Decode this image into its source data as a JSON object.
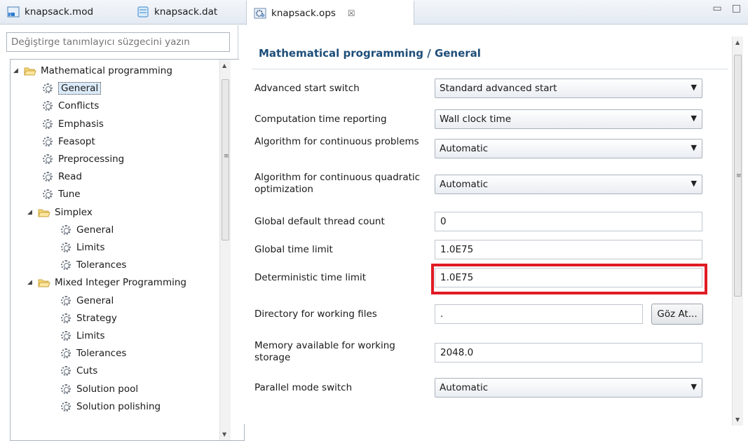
{
  "tabs": [
    {
      "label": "knapsack.mod",
      "icon": "mod-file-icon"
    },
    {
      "label": "knapsack.dat",
      "icon": "data-file-icon"
    },
    {
      "label": "knapsack.ops",
      "icon": "settings-file-icon",
      "active": true,
      "close": "☒"
    }
  ],
  "window_controls": {
    "minimize": "▭",
    "maximize": "□"
  },
  "filter": {
    "placeholder": "Değiştirge tanımlayıcı süzgecini yazın"
  },
  "tree": [
    {
      "label": "Mathematical programming",
      "type": "folder"
    },
    {
      "label": "General",
      "type": "leaf",
      "selected": true
    },
    {
      "label": "Conflicts",
      "type": "leaf"
    },
    {
      "label": "Emphasis",
      "type": "leaf"
    },
    {
      "label": "Feasopt",
      "type": "leaf"
    },
    {
      "label": "Preprocessing",
      "type": "leaf"
    },
    {
      "label": "Read",
      "type": "leaf"
    },
    {
      "label": "Tune",
      "type": "leaf"
    },
    {
      "label": "Simplex",
      "type": "folder"
    },
    {
      "label": "General",
      "type": "leaf"
    },
    {
      "label": "Limits",
      "type": "leaf"
    },
    {
      "label": "Tolerances",
      "type": "leaf"
    },
    {
      "label": "Mixed Integer Programming",
      "type": "folder"
    },
    {
      "label": "General",
      "type": "leaf"
    },
    {
      "label": "Strategy",
      "type": "leaf"
    },
    {
      "label": "Limits",
      "type": "leaf"
    },
    {
      "label": "Tolerances",
      "type": "leaf"
    },
    {
      "label": "Cuts",
      "type": "leaf"
    },
    {
      "label": "Solution pool",
      "type": "leaf"
    },
    {
      "label": "Solution polishing",
      "type": "leaf"
    }
  ],
  "panel": {
    "title": "Mathematical programming / General",
    "fields": [
      {
        "label": "Advanced start switch",
        "kind": "select",
        "value": "Standard advanced start"
      },
      {
        "label": "Computation time reporting",
        "kind": "select",
        "value": "Wall clock time"
      },
      {
        "label": "Algorithm for continuous problems",
        "kind": "select",
        "value": "Automatic"
      },
      {
        "label": "Algorithm for continuous quadratic optimization",
        "kind": "select",
        "value": "Automatic"
      },
      {
        "label": "Global default thread count",
        "kind": "text",
        "value": "0"
      },
      {
        "label": "Global time limit",
        "kind": "text",
        "value": "1.0E75"
      },
      {
        "label": "Deterministic time limit",
        "kind": "text",
        "value": "1.0E75",
        "highlighted": true
      },
      {
        "label": "Directory for working files",
        "kind": "dir",
        "value": ".",
        "button": "Göz At..."
      },
      {
        "label": "Memory available for working storage",
        "kind": "text",
        "value": "2048.0"
      },
      {
        "label": "Parallel mode switch",
        "kind": "select",
        "value": "Automatic"
      }
    ]
  },
  "highlight_color": "#e01b24",
  "title_color": "#1e4e79"
}
